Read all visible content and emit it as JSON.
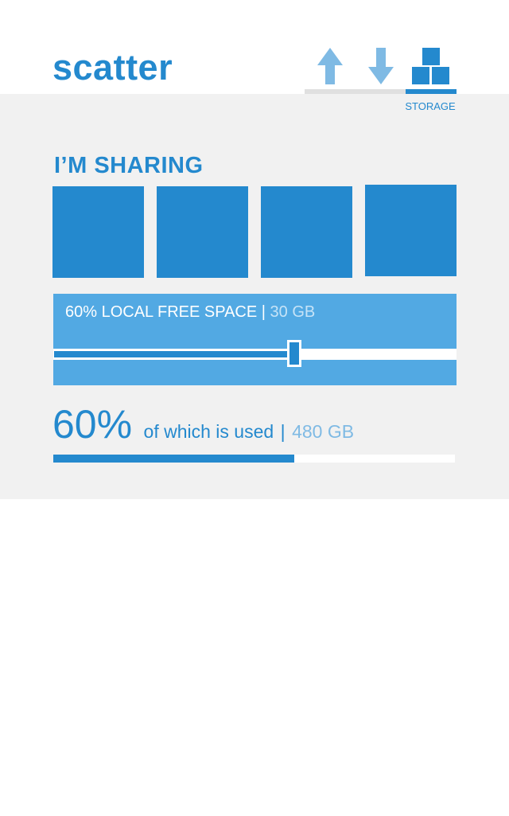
{
  "header": {
    "logo": "scatter",
    "tabs": [
      {
        "id": "upload",
        "icon": "arrow-up-icon",
        "label": ""
      },
      {
        "id": "download",
        "icon": "arrow-down-icon",
        "label": ""
      },
      {
        "id": "storage",
        "icon": "boxes-stack-icon",
        "label": "STORAGE",
        "active": true
      }
    ]
  },
  "sharing": {
    "title": "I’M SHARING",
    "tiles": 4
  },
  "slider": {
    "percent_text": "60% LOCAL FREE SPACE",
    "separator": "|",
    "size_text": "30 GB",
    "value_fraction": 0.6
  },
  "usage": {
    "percent": "60%",
    "text": "of which is used",
    "separator": "|",
    "size": "480 GB",
    "value_fraction": 0.6
  },
  "colors": {
    "accent": "#2489ce",
    "light_accent": "#52a9e3",
    "icon_light": "#7fbae4",
    "panel_bg": "#f1f1f1"
  }
}
